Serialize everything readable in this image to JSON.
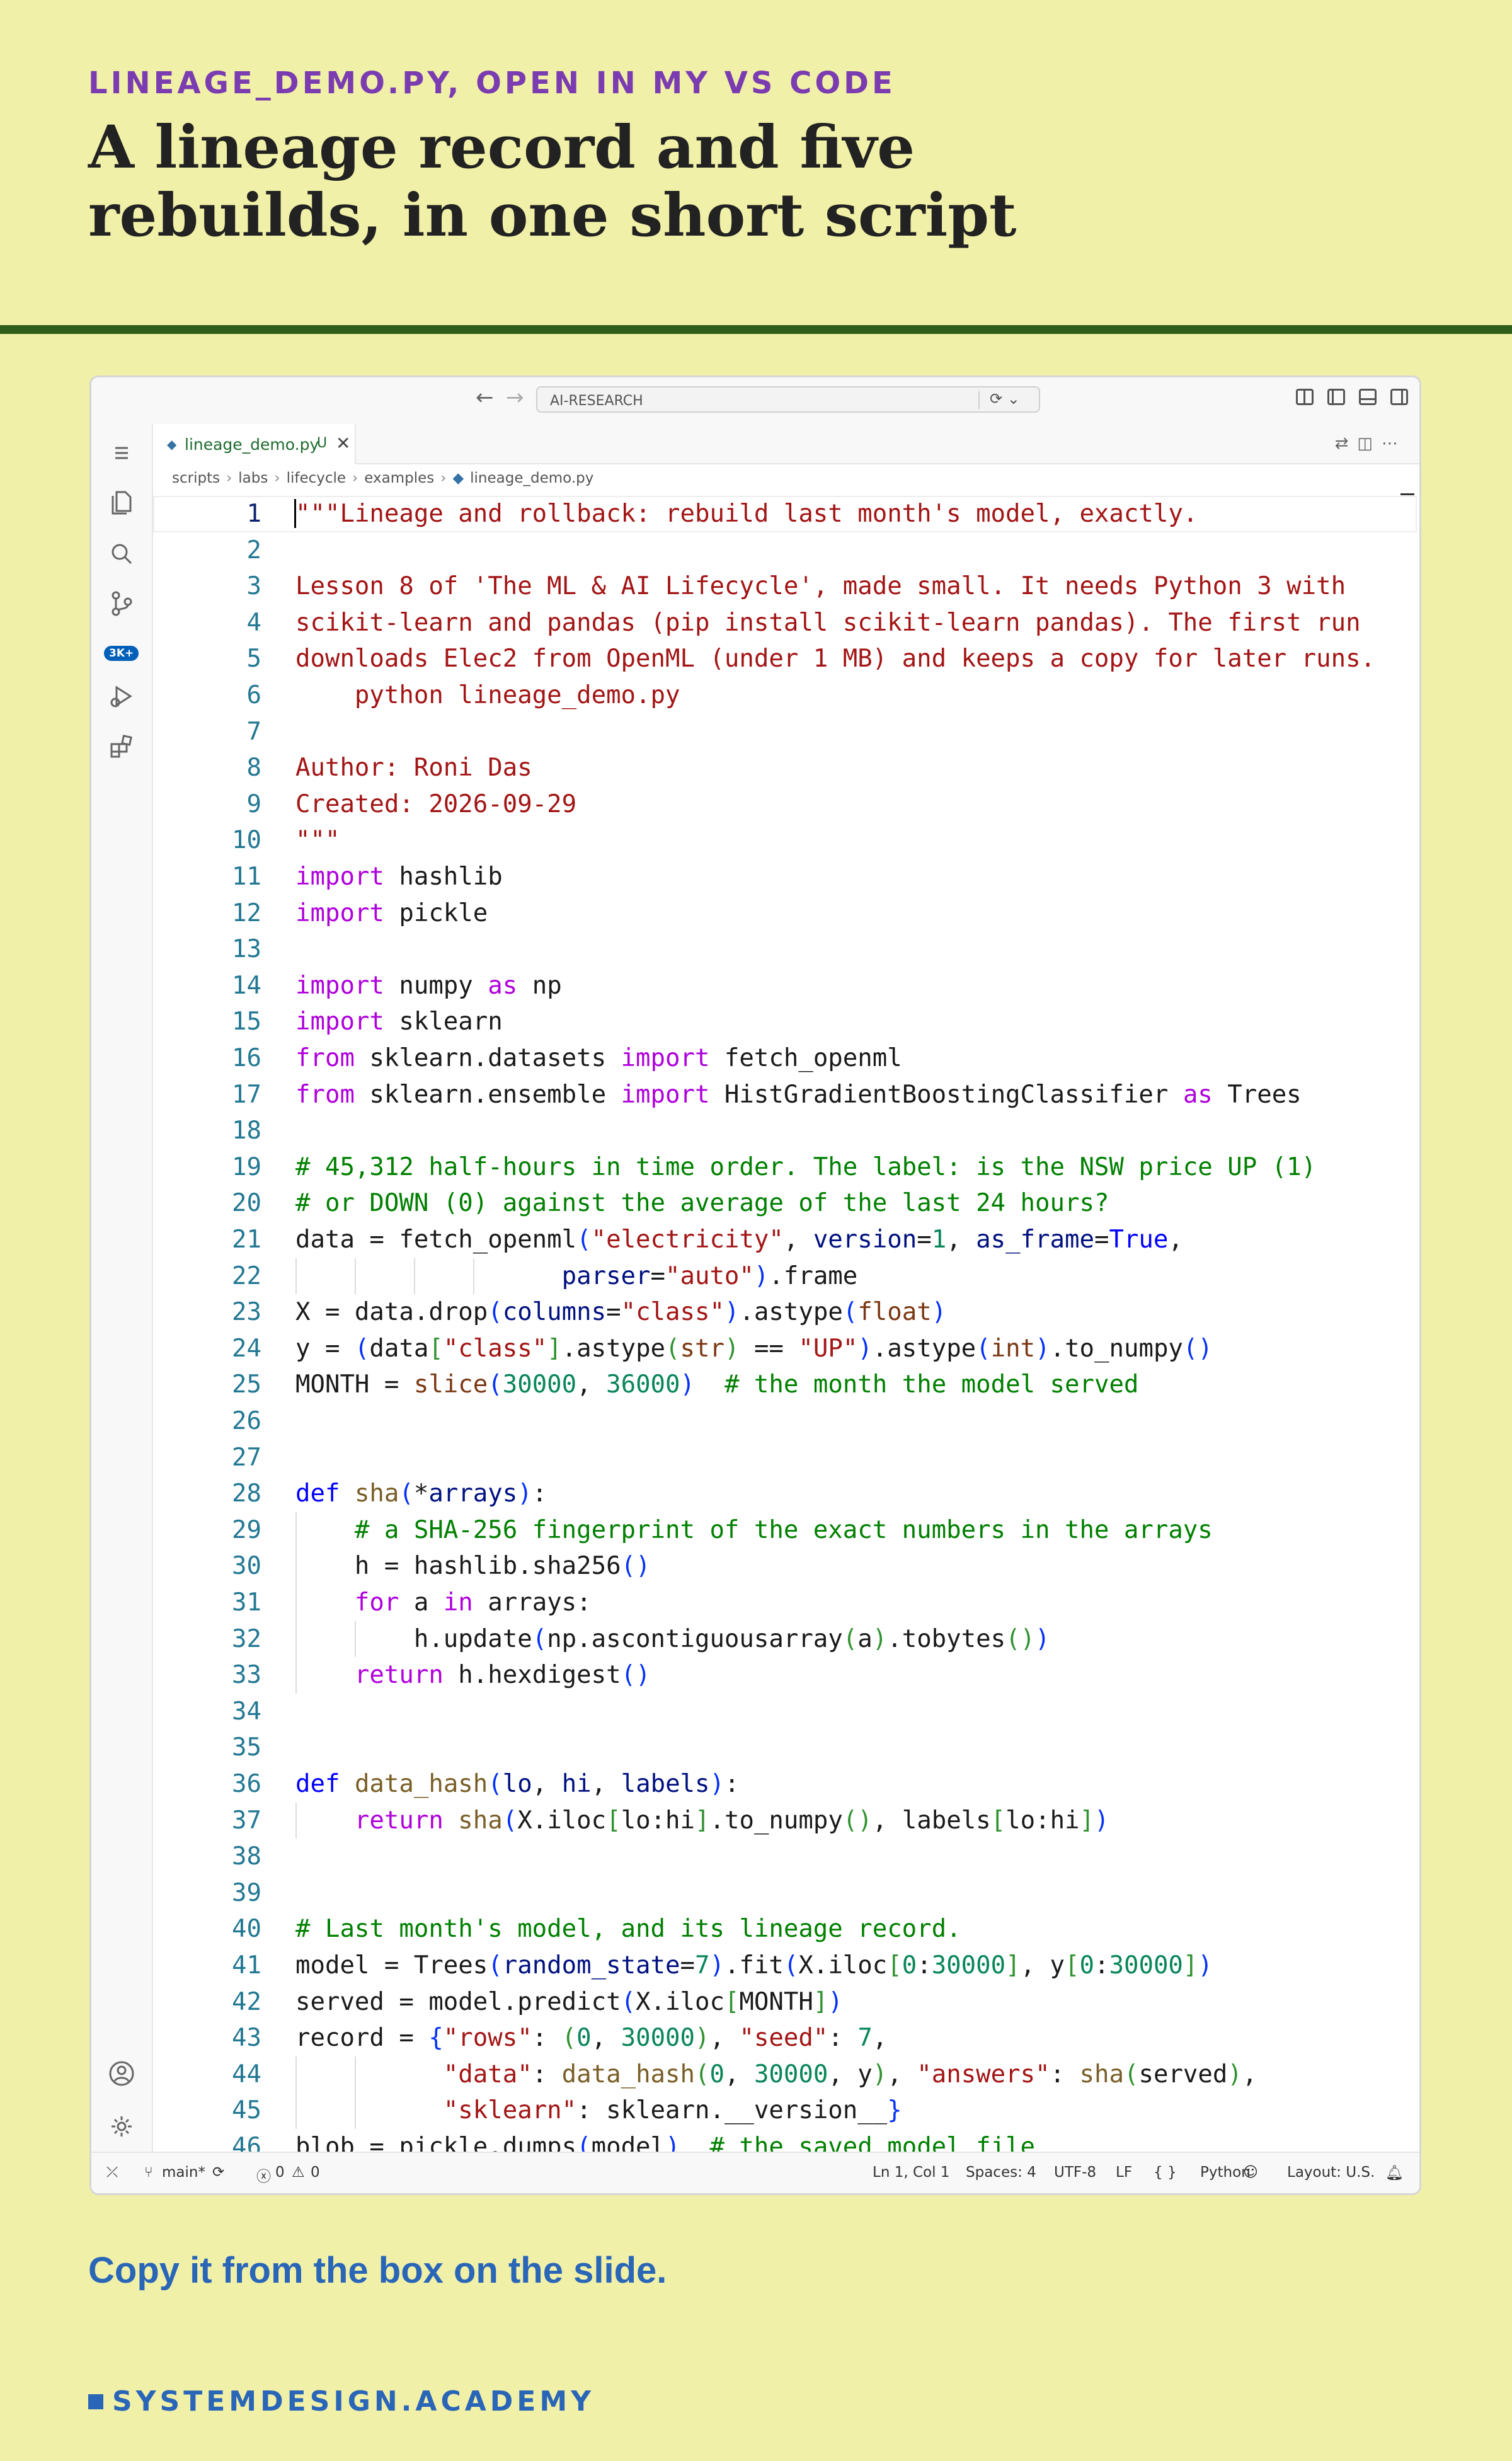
{
  "slide": {
    "kicker": "LINEAGE_DEMO.PY, OPEN IN MY VS CODE",
    "headline": "A lineage record and five rebuilds, in one short script",
    "cta": "Copy it from the box on the slide.",
    "brand": "SYSTEMDESIGN.ACADEMY"
  },
  "window": {
    "command_center": "AI-RESEARCH",
    "tab": {
      "filename": "lineage_demo.py",
      "status": "U"
    },
    "breadcrumb": [
      "scripts",
      "labs",
      "lifecycle",
      "examples",
      "lineage_demo.py"
    ],
    "activity_badge": "3K+"
  },
  "editor": {
    "active_line": 1,
    "lines": [
      {
        "n": "1",
        "tokens": [
          [
            "s",
            "\"\"\"Lineage and rollback: rebuild last month's model, exactly."
          ]
        ]
      },
      {
        "n": "2",
        "tokens": []
      },
      {
        "n": "3",
        "tokens": [
          [
            "s",
            "Lesson 8 of 'The ML & AI Lifecycle', made small. It needs Python 3 with"
          ]
        ]
      },
      {
        "n": "4",
        "tokens": [
          [
            "s",
            "scikit-learn and pandas (pip install scikit-learn pandas). The first run"
          ]
        ]
      },
      {
        "n": "5",
        "tokens": [
          [
            "s",
            "downloads Elec2 from OpenML (under 1 MB) and keeps a copy for later runs."
          ]
        ]
      },
      {
        "n": "6",
        "tokens": [
          [
            "s",
            "    python lineage_demo.py"
          ]
        ]
      },
      {
        "n": "7",
        "tokens": []
      },
      {
        "n": "8",
        "tokens": [
          [
            "s",
            "Author: Roni Das"
          ]
        ]
      },
      {
        "n": "9",
        "tokens": [
          [
            "s",
            "Created: 2026-09-29"
          ]
        ]
      },
      {
        "n": "10",
        "tokens": [
          [
            "s",
            "\"\"\""
          ]
        ]
      },
      {
        "n": "11",
        "tokens": [
          [
            "k",
            "import"
          ],
          [
            "t",
            " hashlib"
          ]
        ]
      },
      {
        "n": "12",
        "tokens": [
          [
            "k",
            "import"
          ],
          [
            "t",
            " pickle"
          ]
        ]
      },
      {
        "n": "13",
        "tokens": []
      },
      {
        "n": "14",
        "tokens": [
          [
            "k",
            "import"
          ],
          [
            "t",
            " numpy "
          ],
          [
            "k",
            "as"
          ],
          [
            "t",
            " np"
          ]
        ]
      },
      {
        "n": "15",
        "tokens": [
          [
            "k",
            "import"
          ],
          [
            "t",
            " sklearn"
          ]
        ]
      },
      {
        "n": "16",
        "tokens": [
          [
            "k",
            "from"
          ],
          [
            "t",
            " sklearn.datasets "
          ],
          [
            "k",
            "import"
          ],
          [
            "t",
            " fetch_openml"
          ]
        ]
      },
      {
        "n": "17",
        "tokens": [
          [
            "k",
            "from"
          ],
          [
            "t",
            " sklearn.ensemble "
          ],
          [
            "k",
            "import"
          ],
          [
            "t",
            " HistGradientBoostingClassifier "
          ],
          [
            "k",
            "as"
          ],
          [
            "t",
            " Trees"
          ]
        ]
      },
      {
        "n": "18",
        "tokens": []
      },
      {
        "n": "19",
        "tokens": [
          [
            "c",
            "# 45,312 half-hours in time order. The label: is the NSW price UP (1)"
          ]
        ]
      },
      {
        "n": "20",
        "tokens": [
          [
            "c",
            "# or DOWN (0) against the average of the last 24 hours?"
          ]
        ]
      },
      {
        "n": "21",
        "tokens": [
          [
            "t",
            "data = fetch_openml"
          ],
          [
            "b1",
            "("
          ],
          [
            "s",
            "\"electricity\""
          ],
          [
            "t",
            ", "
          ],
          [
            "p",
            "version"
          ],
          [
            "t",
            "="
          ],
          [
            "n",
            "1"
          ],
          [
            "t",
            ", "
          ],
          [
            "p",
            "as_frame"
          ],
          [
            "t",
            "="
          ],
          [
            "d",
            "True"
          ],
          [
            "t",
            ","
          ]
        ]
      },
      {
        "n": "22",
        "tokens": [
          [
            "t",
            "                  "
          ],
          [
            "p",
            "parser"
          ],
          [
            "t",
            "="
          ],
          [
            "s",
            "\"auto\""
          ],
          [
            "b1",
            ")"
          ],
          [
            "t",
            ".frame"
          ]
        ]
      },
      {
        "n": "23",
        "tokens": [
          [
            "t",
            "X = data.drop"
          ],
          [
            "b1",
            "("
          ],
          [
            "p",
            "columns"
          ],
          [
            "t",
            "="
          ],
          [
            "s",
            "\"class\""
          ],
          [
            "b1",
            ")"
          ],
          [
            "t",
            ".astype"
          ],
          [
            "b1",
            "("
          ],
          [
            "g",
            "float"
          ],
          [
            "b1",
            ")"
          ]
        ]
      },
      {
        "n": "24",
        "tokens": [
          [
            "t",
            "y = "
          ],
          [
            "b1",
            "("
          ],
          [
            "t",
            "data"
          ],
          [
            "b2",
            "["
          ],
          [
            "s",
            "\"class\""
          ],
          [
            "b2",
            "]"
          ],
          [
            "t",
            ".astype"
          ],
          [
            "b2",
            "("
          ],
          [
            "g",
            "str"
          ],
          [
            "b2",
            ")"
          ],
          [
            "t",
            " == "
          ],
          [
            "s",
            "\"UP\""
          ],
          [
            "b1",
            ")"
          ],
          [
            "t",
            ".astype"
          ],
          [
            "b1",
            "("
          ],
          [
            "g",
            "int"
          ],
          [
            "b1",
            ")"
          ],
          [
            "t",
            ".to_numpy"
          ],
          [
            "b1",
            "()"
          ]
        ]
      },
      {
        "n": "25",
        "tokens": [
          [
            "t",
            "MONTH = "
          ],
          [
            "g",
            "slice"
          ],
          [
            "b1",
            "("
          ],
          [
            "n",
            "30000"
          ],
          [
            "t",
            ", "
          ],
          [
            "n",
            "36000"
          ],
          [
            "b1",
            ")"
          ],
          [
            "t",
            "  "
          ],
          [
            "c",
            "# the month the model served"
          ]
        ]
      },
      {
        "n": "26",
        "tokens": []
      },
      {
        "n": "27",
        "tokens": []
      },
      {
        "n": "28",
        "tokens": [
          [
            "d",
            "def"
          ],
          [
            "t",
            " "
          ],
          [
            "f",
            "sha"
          ],
          [
            "b1",
            "("
          ],
          [
            "t",
            "*"
          ],
          [
            "p",
            "arrays"
          ],
          [
            "b1",
            ")"
          ],
          [
            "t",
            ":"
          ]
        ]
      },
      {
        "n": "29",
        "tokens": [
          [
            "t",
            "    "
          ],
          [
            "c",
            "# a SHA-256 fingerprint of the exact numbers in the arrays"
          ]
        ]
      },
      {
        "n": "30",
        "tokens": [
          [
            "t",
            "    h = hashlib.sha256"
          ],
          [
            "b1",
            "()"
          ]
        ]
      },
      {
        "n": "31",
        "tokens": [
          [
            "t",
            "    "
          ],
          [
            "k",
            "for"
          ],
          [
            "t",
            " a "
          ],
          [
            "k",
            "in"
          ],
          [
            "t",
            " arrays:"
          ]
        ]
      },
      {
        "n": "32",
        "tokens": [
          [
            "t",
            "        h.update"
          ],
          [
            "b1",
            "("
          ],
          [
            "t",
            "np.ascontiguousarray"
          ],
          [
            "b2",
            "("
          ],
          [
            "t",
            "a"
          ],
          [
            "b2",
            ")"
          ],
          [
            "t",
            ".tobytes"
          ],
          [
            "b2",
            "()"
          ],
          [
            "b1",
            ")"
          ]
        ]
      },
      {
        "n": "33",
        "tokens": [
          [
            "t",
            "    "
          ],
          [
            "k",
            "return"
          ],
          [
            "t",
            " h.hexdigest"
          ],
          [
            "b1",
            "()"
          ]
        ]
      },
      {
        "n": "34",
        "tokens": []
      },
      {
        "n": "35",
        "tokens": []
      },
      {
        "n": "36",
        "tokens": [
          [
            "d",
            "def"
          ],
          [
            "t",
            " "
          ],
          [
            "f",
            "data_hash"
          ],
          [
            "b1",
            "("
          ],
          [
            "p",
            "lo"
          ],
          [
            "t",
            ", "
          ],
          [
            "p",
            "hi"
          ],
          [
            "t",
            ", "
          ],
          [
            "p",
            "labels"
          ],
          [
            "b1",
            ")"
          ],
          [
            "t",
            ":"
          ]
        ]
      },
      {
        "n": "37",
        "tokens": [
          [
            "t",
            "    "
          ],
          [
            "k",
            "return"
          ],
          [
            "t",
            " "
          ],
          [
            "f",
            "sha"
          ],
          [
            "b1",
            "("
          ],
          [
            "t",
            "X.iloc"
          ],
          [
            "b2",
            "["
          ],
          [
            "t",
            "lo:hi"
          ],
          [
            "b2",
            "]"
          ],
          [
            "t",
            ".to_numpy"
          ],
          [
            "b2",
            "()"
          ],
          [
            "t",
            ", labels"
          ],
          [
            "b2",
            "["
          ],
          [
            "t",
            "lo:hi"
          ],
          [
            "b2",
            "]"
          ],
          [
            "b1",
            ")"
          ]
        ]
      },
      {
        "n": "38",
        "tokens": []
      },
      {
        "n": "39",
        "tokens": []
      },
      {
        "n": "40",
        "tokens": [
          [
            "c",
            "# Last month's model, and its lineage record."
          ]
        ]
      },
      {
        "n": "41",
        "tokens": [
          [
            "t",
            "model = Trees"
          ],
          [
            "b1",
            "("
          ],
          [
            "p",
            "random_state"
          ],
          [
            "t",
            "="
          ],
          [
            "n",
            "7"
          ],
          [
            "b1",
            ")"
          ],
          [
            "t",
            ".fit"
          ],
          [
            "b1",
            "("
          ],
          [
            "t",
            "X.iloc"
          ],
          [
            "b2",
            "["
          ],
          [
            "n",
            "0"
          ],
          [
            "t",
            ":"
          ],
          [
            "n",
            "30000"
          ],
          [
            "b2",
            "]"
          ],
          [
            "t",
            ", y"
          ],
          [
            "b2",
            "["
          ],
          [
            "n",
            "0"
          ],
          [
            "t",
            ":"
          ],
          [
            "n",
            "30000"
          ],
          [
            "b2",
            "]"
          ],
          [
            "b1",
            ")"
          ]
        ]
      },
      {
        "n": "42",
        "tokens": [
          [
            "t",
            "served = model.predict"
          ],
          [
            "b1",
            "("
          ],
          [
            "t",
            "X.iloc"
          ],
          [
            "b2",
            "["
          ],
          [
            "t",
            "MONTH"
          ],
          [
            "b2",
            "]"
          ],
          [
            "b1",
            ")"
          ]
        ]
      },
      {
        "n": "43",
        "tokens": [
          [
            "t",
            "record = "
          ],
          [
            "b1",
            "{"
          ],
          [
            "s",
            "\"rows\""
          ],
          [
            "t",
            ": "
          ],
          [
            "b2",
            "("
          ],
          [
            "n",
            "0"
          ],
          [
            "t",
            ", "
          ],
          [
            "n",
            "30000"
          ],
          [
            "b2",
            ")"
          ],
          [
            "t",
            ", "
          ],
          [
            "s",
            "\"seed\""
          ],
          [
            "t",
            ": "
          ],
          [
            "n",
            "7"
          ],
          [
            "t",
            ","
          ]
        ]
      },
      {
        "n": "44",
        "tokens": [
          [
            "t",
            "          "
          ],
          [
            "s",
            "\"data\""
          ],
          [
            "t",
            ": "
          ],
          [
            "f",
            "data_hash"
          ],
          [
            "b2",
            "("
          ],
          [
            "n",
            "0"
          ],
          [
            "t",
            ", "
          ],
          [
            "n",
            "30000"
          ],
          [
            "t",
            ", y"
          ],
          [
            "b2",
            ")"
          ],
          [
            "t",
            ", "
          ],
          [
            "s",
            "\"answers\""
          ],
          [
            "t",
            ": "
          ],
          [
            "f",
            "sha"
          ],
          [
            "b2",
            "("
          ],
          [
            "t",
            "served"
          ],
          [
            "b2",
            ")"
          ],
          [
            "t",
            ","
          ]
        ]
      },
      {
        "n": "45",
        "tokens": [
          [
            "t",
            "          "
          ],
          [
            "s",
            "\"sklearn\""
          ],
          [
            "t",
            ": sklearn.__version__"
          ],
          [
            "b1",
            "}"
          ]
        ]
      },
      {
        "n": "46",
        "tokens": [
          [
            "t",
            "blob = pickle.dumps"
          ],
          [
            "b1",
            "("
          ],
          [
            "t",
            "model"
          ],
          [
            "b1",
            ")"
          ],
          [
            "t",
            "  "
          ],
          [
            "c",
            "# the saved model file"
          ]
        ]
      }
    ]
  },
  "statusbar": {
    "branch": "main*",
    "errors": "0",
    "warnings": "0",
    "position": "Ln 1, Col 1",
    "spaces": "Spaces: 4",
    "encoding": "UTF-8",
    "eol": "LF",
    "language": "Python",
    "braces": "{ }",
    "layout": "Layout: U.S."
  }
}
